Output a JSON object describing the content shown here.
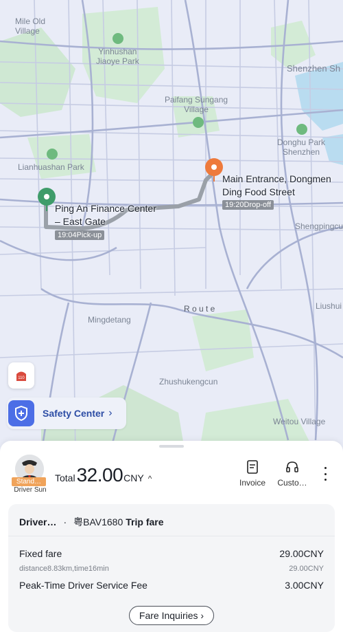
{
  "map": {
    "place_labels": [
      {
        "text": "Mile Old Village",
        "line1": "Mile Old",
        "line2": "Village"
      },
      {
        "text": "Yinhushan Jiaoye Park",
        "line1": "Yinhushan",
        "line2": "Jiaoye Park"
      },
      {
        "text": "Shenzhen Shi",
        "line1": "Shenzhen Sh",
        "line2": ""
      },
      {
        "text": "Paifang Sungang Village",
        "line1": "Paifang Sungang",
        "line2": "Village"
      },
      {
        "text": "Donghu Park Shenzhen",
        "line1": "Donghu Park",
        "line2": "Shenzhen"
      },
      {
        "text": "Lianhuashan Park",
        "line1": "Lianhuashan Park",
        "line2": ""
      },
      {
        "text": "Shengpingcun",
        "line1": "Shengpingcu",
        "line2": ""
      },
      {
        "text": "Liushui",
        "line1": "Liushui",
        "line2": ""
      },
      {
        "text": "Mingdetang",
        "line1": "Mingdetang",
        "line2": ""
      },
      {
        "text": "Zhushukengcun",
        "line1": "Zhushukengcun",
        "line2": ""
      },
      {
        "text": "Weitou Village",
        "line1": "Weitou Village",
        "line2": ""
      },
      {
        "text": "Route",
        "line1": "R o u t e",
        "line2": ""
      }
    ],
    "pickup": {
      "name_line1": "Ping An Finance Center",
      "name_line2": "– East Gate",
      "time_tag": "19:04Pick-up",
      "color": "#3f9c6a"
    },
    "dropoff": {
      "name_line1": "Main Entrance, Dongmen",
      "name_line2": "Ding Food Street",
      "time_tag": "19:20Drop-off",
      "color": "#ee7a3c"
    },
    "emergency_label": "110",
    "safety_center": {
      "label": "Safety Center",
      "chevron": "›"
    }
  },
  "trip": {
    "driver_badge": "Stand…",
    "driver_name": "Driver Sun",
    "total_label": "Total",
    "total_amount": "32.00",
    "currency": "CNY",
    "caret": "^",
    "actions": [
      {
        "label": "Invoice",
        "icon": "invoice-icon"
      },
      {
        "label": "Custo…",
        "icon": "headset-icon"
      }
    ],
    "more_icon": "more-vertical-icon",
    "breakdown": {
      "driver_label": "Driver…",
      "separator": "·",
      "plate": "粤BAV1680",
      "title": "Trip fare",
      "items": [
        {
          "name": "Fixed fare",
          "amount": "29.00CNY"
        },
        {
          "name": "distance8.83km,time16min",
          "amount": "29.00CNY"
        },
        {
          "name": "Peak-Time Driver Service Fee",
          "amount": "3.00CNY"
        }
      ],
      "fare_inquiries": "Fare Inquiries ›"
    }
  },
  "colors": {
    "accent": "#4c6ee6",
    "pickup": "#3f9c6a",
    "dropoff": "#ee7a3c",
    "route": "#9aa0a8"
  }
}
